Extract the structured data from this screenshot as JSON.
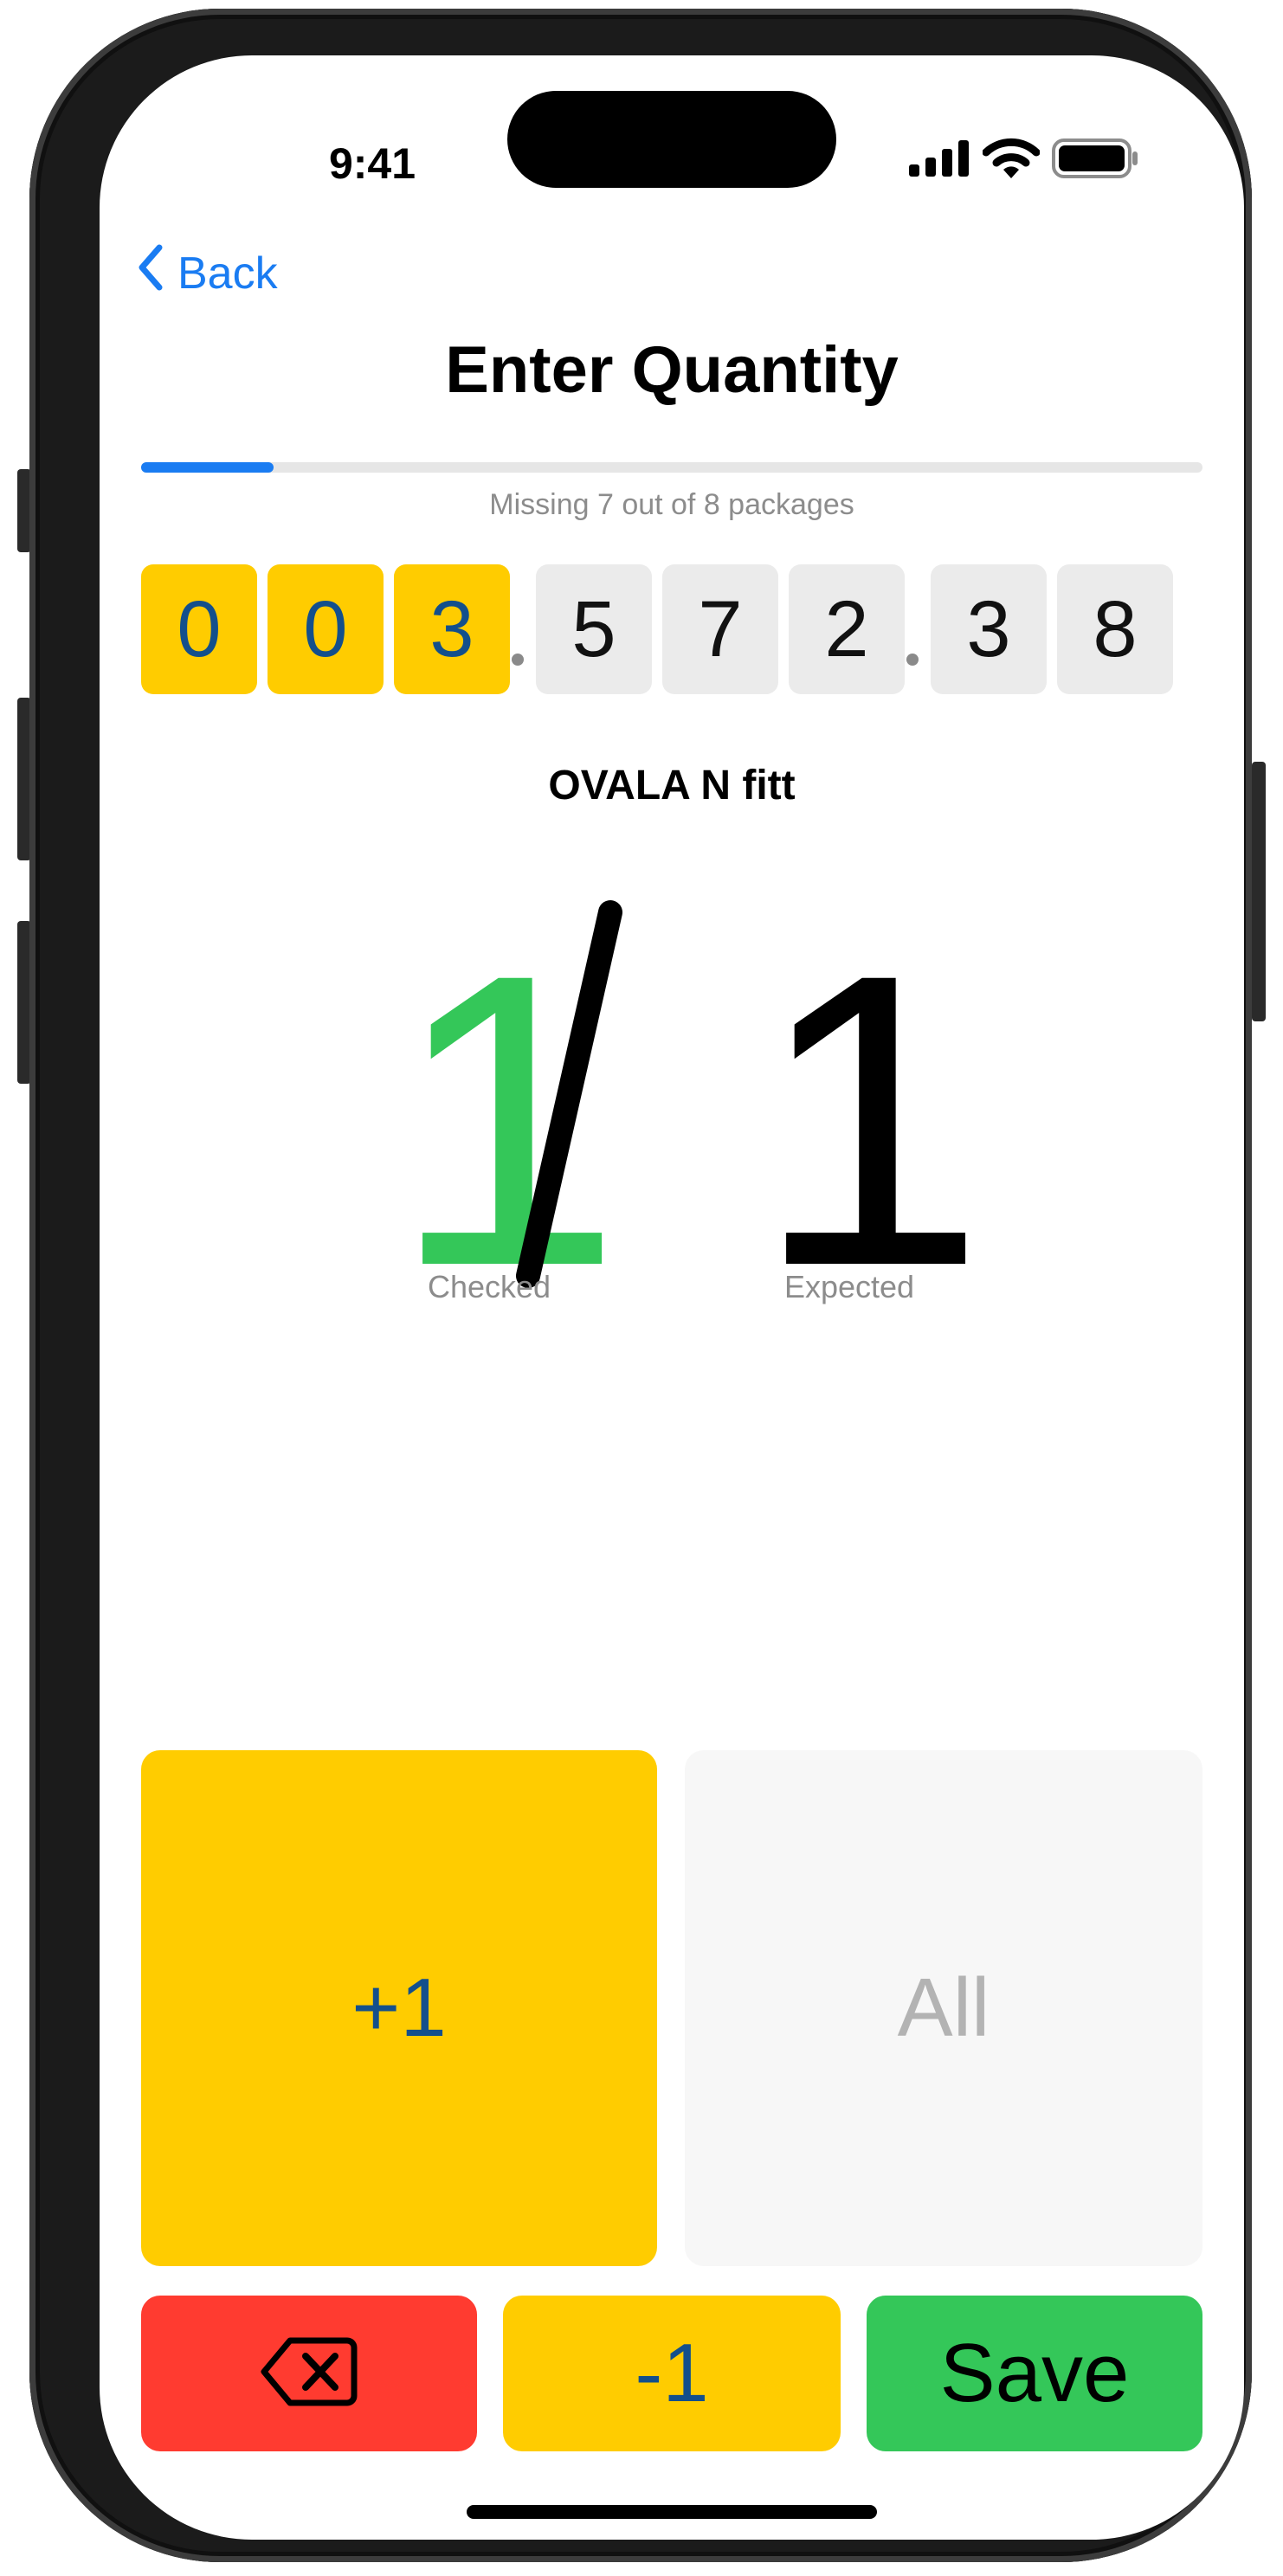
{
  "status_bar": {
    "time": "9:41"
  },
  "nav": {
    "back_label": "Back"
  },
  "page": {
    "title": "Enter Quantity"
  },
  "progress": {
    "fraction": 0.125,
    "text": "Missing 7 out of 8 packages"
  },
  "article_number": {
    "groups": [
      {
        "digits": [
          "0",
          "0",
          "3"
        ],
        "highlighted": true
      },
      {
        "digits": [
          "5",
          "7",
          "2"
        ],
        "highlighted": false
      },
      {
        "digits": [
          "3",
          "8"
        ],
        "highlighted": false
      }
    ]
  },
  "product": {
    "name": "OVALA N fitt"
  },
  "counter": {
    "checked": "1",
    "expected": "1",
    "checked_label": "Checked",
    "expected_label": "Expected"
  },
  "buttons": {
    "plus_one": "+1",
    "all": "All",
    "minus_one": "-1",
    "save": "Save",
    "delete_icon": "backspace-icon"
  },
  "colors": {
    "accent_blue": "#1a7cf2",
    "yellow": "#ffcc00",
    "green": "#34c759",
    "red": "#ff3b30",
    "digit_blue": "#134f8c"
  }
}
